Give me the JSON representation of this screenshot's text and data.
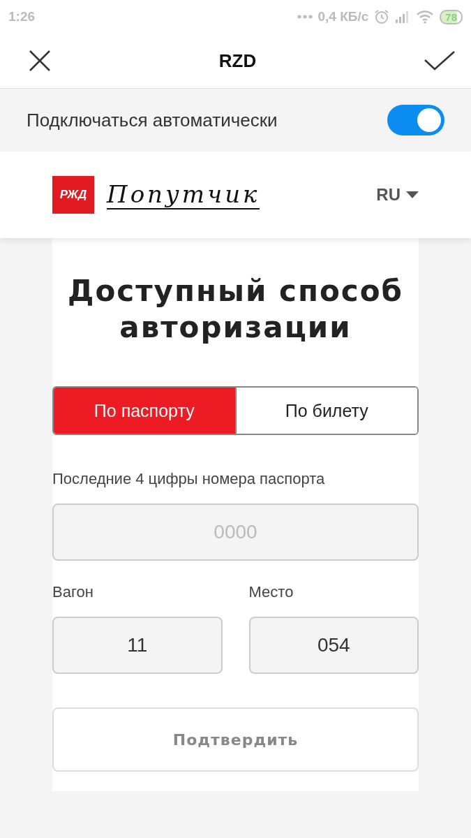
{
  "status_bar": {
    "time": "1:26",
    "speed": "0,4 КБ/с",
    "battery": "78"
  },
  "app_bar": {
    "title": "RZD"
  },
  "auto_connect": {
    "label": "Подключаться автоматически",
    "on": true
  },
  "site_header": {
    "logo_mark": "РЖД",
    "logo_text": "Попутчик",
    "language": "RU"
  },
  "heading": "Доступный способ авторизации",
  "tabs": [
    {
      "label": "По паспорту",
      "selected": true
    },
    {
      "label": "По билету",
      "selected": false
    }
  ],
  "passport_field": {
    "label": "Последние 4 цифры номера паспорта",
    "placeholder": "0000"
  },
  "car_field": {
    "label": "Вагон",
    "value": "11"
  },
  "seat_field": {
    "label": "Место",
    "value": "054"
  },
  "confirm_button": {
    "label": "Подтвердить",
    "disabled": true
  }
}
